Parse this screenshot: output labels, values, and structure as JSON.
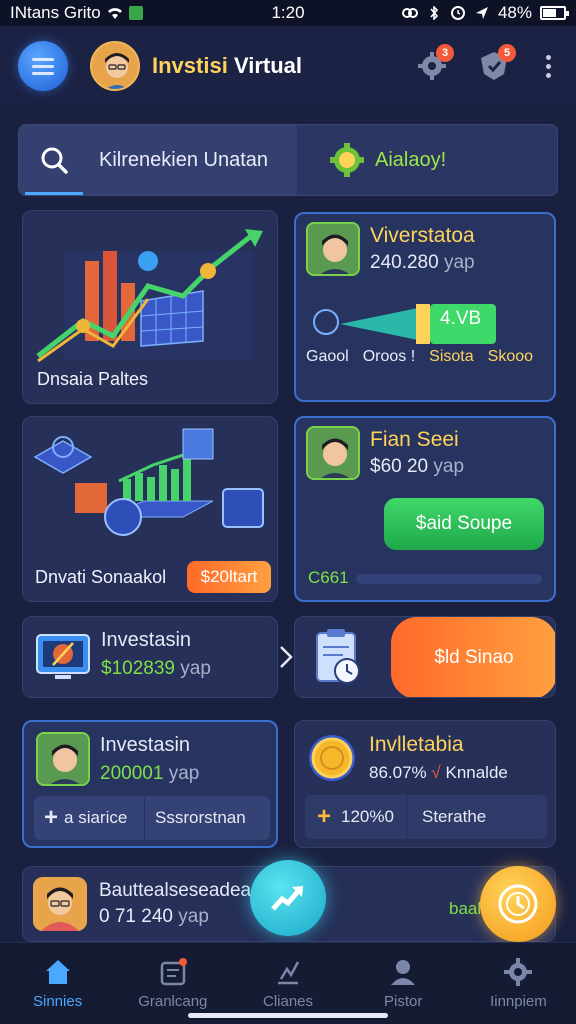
{
  "status_bar": {
    "carrier": "INtans Grito",
    "time": "1:20",
    "battery": "48%"
  },
  "header": {
    "title_part1": "Invstisi",
    "title_part2": "Virtual",
    "settings_badge": "3",
    "shield_badge": "5"
  },
  "search_row": {
    "search_label": "Kilrenekien Unatan",
    "alert_label": "Aialaoy!"
  },
  "cards": {
    "chart_card_label": "Dnsaia Paltes",
    "invest_card": {
      "title": "Viverstatoa",
      "amount": "240.280",
      "unit": "yap",
      "progress_value": "4.VB",
      "labels": [
        "Gaool",
        "Oroos !",
        "Sisota",
        "Skooo"
      ]
    },
    "iso_card": {
      "label": "Dnvati Sonaakol",
      "button": "$20ltart"
    },
    "plan_card": {
      "title": "Fian Seei",
      "amount": "$60 20",
      "unit": "yap",
      "button": "$aid Soupe",
      "footer": "C661"
    },
    "investasin_card1": {
      "title": "Investasin",
      "amount": "$102839",
      "unit": "yap"
    },
    "orange_card": {
      "button": "$ld Sinao"
    },
    "investasin_card2": {
      "title": "Investasin",
      "amount": "200001",
      "unit": "yap",
      "bar_left": "a siarice",
      "bar_right": "Sssrorstnan"
    },
    "coin_card": {
      "title": "Invlletabia",
      "amount": "86.07%",
      "mark": "√",
      "suffix": "Knnalde",
      "bar_left": "120%0",
      "bar_right": "Sterathe"
    },
    "bottom_card": {
      "title": "Bauttealseseadea",
      "amount": "0 71 240",
      "unit": "yap",
      "right_text": "baah"
    }
  },
  "bottom_nav": {
    "items": [
      {
        "label": "Sinnies",
        "icon": "home-icon"
      },
      {
        "label": "Granlcang",
        "icon": "calendar-icon"
      },
      {
        "label": "Clianes",
        "icon": "chart-icon"
      },
      {
        "label": "Pistor",
        "icon": "user-icon"
      },
      {
        "label": "Iinnpiem",
        "icon": "gear-icon"
      }
    ]
  },
  "colors": {
    "accent_blue": "#4aa8ff",
    "accent_yellow": "#ffd35a",
    "accent_green": "#7ee04a",
    "accent_orange": "#ff8a3a",
    "background": "#1a2140"
  }
}
